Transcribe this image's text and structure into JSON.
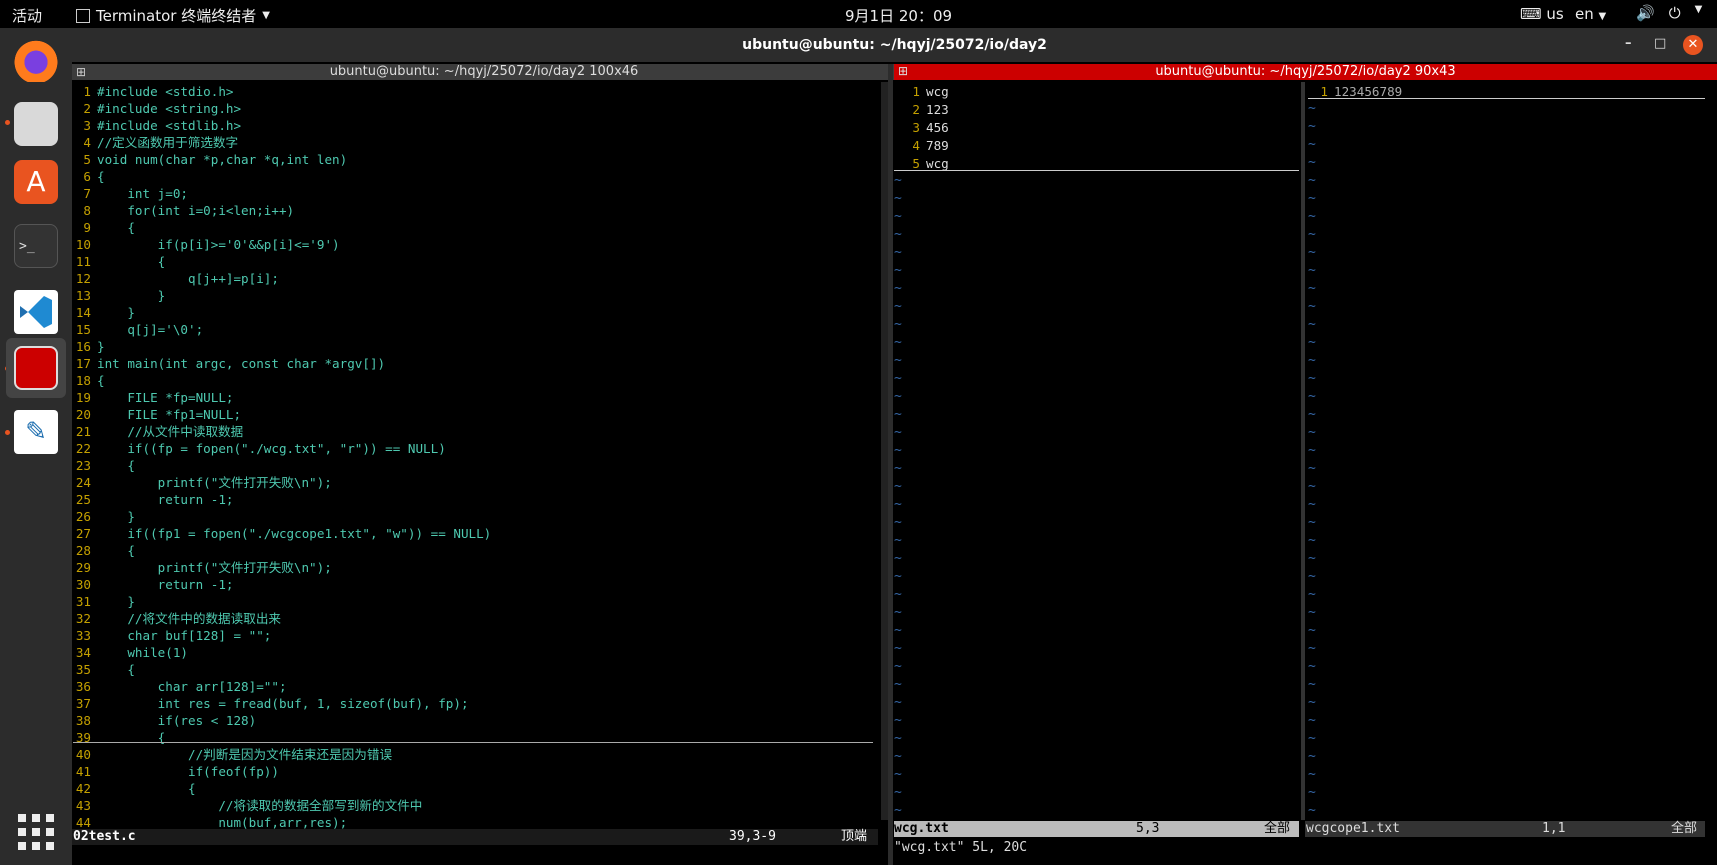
{
  "topbar": {
    "activities": "活动",
    "app_name": "Terminator 终端终结者",
    "clock": "9月1日  20：09",
    "keyboard": "us",
    "language": "en"
  },
  "window": {
    "title": "ubuntu@ubuntu: ~/hqyj/25072/io/day2"
  },
  "left_pane": {
    "title": "ubuntu@ubuntu: ~/hqyj/25072/io/day2 100x46",
    "status_file": "02test.c",
    "status_pos": "39,3-9",
    "status_scroll": "顶端",
    "lines": [
      {
        "n": "1",
        "t": "#include <stdio.h>"
      },
      {
        "n": "2",
        "t": "#include <string.h>"
      },
      {
        "n": "3",
        "t": "#include <stdlib.h>"
      },
      {
        "n": "4",
        "t": "//定义函数用于筛选数字"
      },
      {
        "n": "5",
        "t": "void num(char *p,char *q,int len)"
      },
      {
        "n": "6",
        "t": "{"
      },
      {
        "n": "7",
        "t": "    int j=0;"
      },
      {
        "n": "8",
        "t": "    for(int i=0;i<len;i++)"
      },
      {
        "n": "9",
        "t": "    {"
      },
      {
        "n": "10",
        "t": "        if(p[i]>='0'&&p[i]<='9')"
      },
      {
        "n": "11",
        "t": "        {"
      },
      {
        "n": "12",
        "t": "            q[j++]=p[i];"
      },
      {
        "n": "13",
        "t": "        }"
      },
      {
        "n": "14",
        "t": "    }"
      },
      {
        "n": "15",
        "t": "    q[j]='\\0';"
      },
      {
        "n": "16",
        "t": "}"
      },
      {
        "n": "17",
        "t": "int main(int argc, const char *argv[])"
      },
      {
        "n": "18",
        "t": "{"
      },
      {
        "n": "19",
        "t": "    FILE *fp=NULL;"
      },
      {
        "n": "20",
        "t": "    FILE *fp1=NULL;"
      },
      {
        "n": "21",
        "t": "    //从文件中读取数据"
      },
      {
        "n": "22",
        "t": "    if((fp = fopen(\"./wcg.txt\", \"r\")) == NULL)"
      },
      {
        "n": "23",
        "t": "    {"
      },
      {
        "n": "24",
        "t": "        printf(\"文件打开失败\\n\");"
      },
      {
        "n": "25",
        "t": "        return -1;"
      },
      {
        "n": "26",
        "t": "    }"
      },
      {
        "n": "27",
        "t": "    if((fp1 = fopen(\"./wcgcope1.txt\", \"w\")) == NULL)"
      },
      {
        "n": "28",
        "t": "    {"
      },
      {
        "n": "29",
        "t": "        printf(\"文件打开失败\\n\");"
      },
      {
        "n": "30",
        "t": "        return -1;"
      },
      {
        "n": "31",
        "t": "    }"
      },
      {
        "n": "32",
        "t": "    //将文件中的数据读取出来"
      },
      {
        "n": "33",
        "t": "    char buf[128] = \"\";"
      },
      {
        "n": "34",
        "t": "    while(1)"
      },
      {
        "n": "35",
        "t": "    {"
      },
      {
        "n": "36",
        "t": "        char arr[128]=\"\";"
      },
      {
        "n": "37",
        "t": "        int res = fread(buf, 1, sizeof(buf), fp);"
      },
      {
        "n": "38",
        "t": "        if(res < 128)"
      },
      {
        "n": "39",
        "t": "        {"
      },
      {
        "n": "40",
        "t": "            //判断是因为文件结束还是因为错误"
      },
      {
        "n": "41",
        "t": "            if(feof(fp))"
      },
      {
        "n": "42",
        "t": "            {"
      },
      {
        "n": "43",
        "t": "                //将读取的数据全部写到新的文件中"
      },
      {
        "n": "44",
        "t": "                num(buf,arr,res);"
      }
    ]
  },
  "right_pane": {
    "title": "ubuntu@ubuntu: ~/hqyj/25072/io/day2 90x43",
    "left_lines": [
      {
        "n": "1",
        "t": "wcg"
      },
      {
        "n": "2",
        "t": "123"
      },
      {
        "n": "3",
        "t": "456"
      },
      {
        "n": "4",
        "t": "789"
      },
      {
        "n": "5",
        "t": "wcg"
      }
    ],
    "right_lines": [
      {
        "n": "1",
        "t": "123456789"
      }
    ],
    "status_left_file": "wcg.txt",
    "status_left_pos": "5,3",
    "status_left_scroll": "全部",
    "status_right_file": "wcgcope1.txt",
    "status_right_pos": "1,1",
    "status_right_scroll": "全部",
    "message": "\"wcg.txt\" 5L, 20C"
  },
  "colors": {
    "accent": "#e95420",
    "active_title": "#cc0000",
    "inactive_title": "#3c3c3c"
  }
}
